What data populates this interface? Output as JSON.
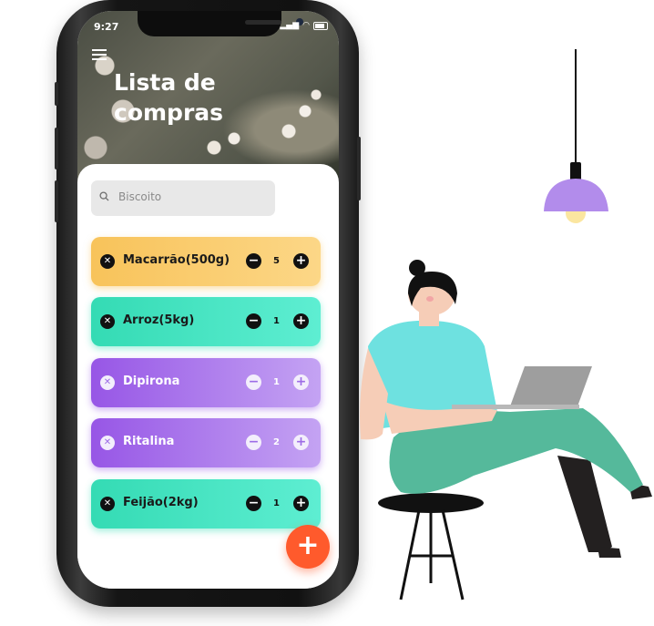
{
  "status_bar": {
    "time": "9:27"
  },
  "app": {
    "title": "Lista de compras",
    "title_line1": "Lista de",
    "title_line2": "compras"
  },
  "search": {
    "placeholder": "Biscoito"
  },
  "items": [
    {
      "name": "Macarrão(500g)",
      "qty": "5",
      "color": "#f8c35a"
    },
    {
      "name": "Arroz(5kg)",
      "qty": "1",
      "color": "#34dbb4"
    },
    {
      "name": "Dipirona",
      "qty": "1",
      "color": "#9756e6"
    },
    {
      "name": "Ritalina",
      "qty": "2",
      "color": "#9756e6"
    },
    {
      "name": "Feijão(2kg)",
      "qty": "1",
      "color": "#34dbb4"
    }
  ],
  "icons": {
    "menu": "hamburger-icon",
    "search": "search-icon",
    "remove": "close-circle-icon",
    "decrement": "minus-circle-icon",
    "increment": "plus-circle-icon",
    "add": "plus-icon"
  },
  "colors": {
    "fab": "#ff5a2c",
    "lamp": "#b28ceb"
  }
}
